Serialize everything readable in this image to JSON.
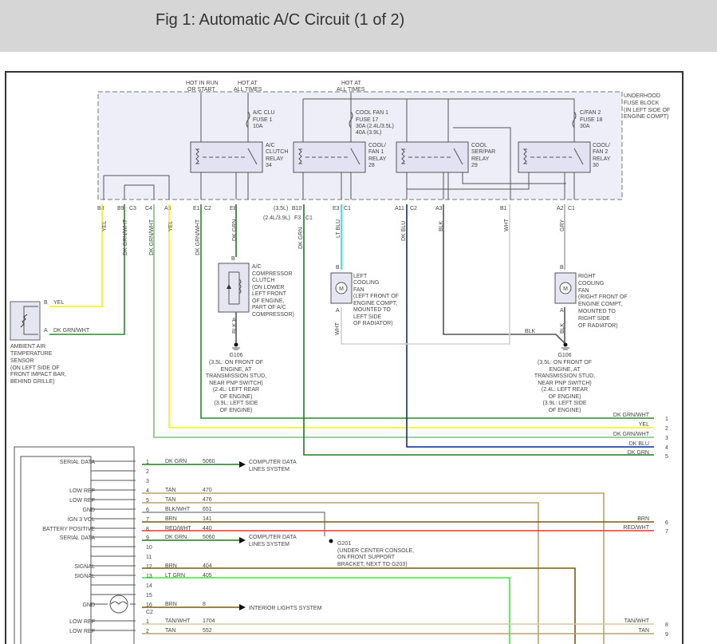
{
  "title": "Fig 1: Automatic A/C Circuit (1 of 2)",
  "colors": {
    "yel": "#f5f500",
    "dkgrnwht": "#2a8a2a",
    "dkgrnwht_lt": "#7fbf7f",
    "dkgrn": "#1f7a1f",
    "ltblu": "#00e5ff",
    "dkblu": "#0a2a9a",
    "blk": "#555555",
    "wht": "#cfcfcf",
    "gry": "#aaaaaa",
    "tan": "#b9a36a",
    "brn": "#7a5a10",
    "red": "#ff3030",
    "ltgrn": "#33ee33",
    "fuseblock": "#eeeef8"
  },
  "fuse_block": {
    "sources": [
      "HOT IN RUN",
      "OR START",
      "HOT AT",
      "ALL TIMES",
      "HOT AT",
      "ALL TIMES"
    ],
    "label": [
      "UNDERHOOD",
      "FUSE BLOCK",
      "(IN LEFT SIDE OF",
      "ENGINE COMPT)"
    ],
    "fuse1": [
      "A/C CLU",
      "FUSE 1",
      "10A"
    ],
    "fuse17": [
      "COOL FAN 1",
      "FUSE 17",
      "30A  (2.4L/3.5L)",
      "40A  (3.9L)"
    ],
    "fuse18": [
      "C/FAN 2",
      "FUSE 18",
      "30A"
    ],
    "relay34": [
      "A/C",
      "CLUTCH",
      "RELAY",
      "34"
    ],
    "relay28": [
      "COOL/",
      "FAN 1",
      "RELAY",
      "28"
    ],
    "relay29": [
      "COOL",
      "SER/PAR",
      "RELAY",
      "29"
    ],
    "relay30": [
      "COOL/",
      "FAN 2",
      "RELAY",
      "30"
    ]
  },
  "pins": [
    "B8",
    "B9",
    "C3",
    "C4",
    "A5",
    "E1",
    "C2",
    "E8",
    "(3.5L)",
    "B10",
    "(2.4L/3.9L)",
    "F3",
    "C1",
    "E3",
    "C1",
    "A11",
    "C2",
    "A3",
    "B1",
    "A2",
    "C1"
  ],
  "wire_labels": [
    "YEL",
    "DK GRN/WHT",
    "DK GRN/WHT",
    "YEL",
    "DK GRN/WHT",
    "DK GRN",
    "DK GRN",
    "LT BLU",
    "DK BLU",
    "BLK",
    "WHT",
    "GRY",
    "BLK",
    "WHT",
    "BLK",
    "BLK"
  ],
  "sensor": {
    "pin_b": "B",
    "pin_a": "A",
    "wire_b": "YEL",
    "wire_a": "DK GRN/WHT",
    "label": [
      "AMBIENT AIR",
      "TEMPERATURE",
      "SENSOR",
      "(ON LEFT SIDE OF",
      "FRONT IMPACT BAR,",
      "BEHIND GRILLE)"
    ]
  },
  "clutch": {
    "pin_b": "B",
    "pin_a": "A",
    "label": [
      "A/C",
      "COMPRESSOR",
      "CLUTCH",
      "(ON LOWER",
      "LEFT FRONT",
      "OF ENGINE,",
      "PART OF A/C",
      "COMPRESSOR)"
    ]
  },
  "left_fan": {
    "pin_b": "B",
    "pin_a": "A",
    "motor": "M",
    "label": [
      "LEFT",
      "COOLING",
      "FAN",
      "(LEFT FRONT OF",
      "ENGINE COMPT,",
      "MOUNTED TO",
      "LEFT SIDE",
      "OF RADIATOR)"
    ]
  },
  "right_fan": {
    "pin_b": "B",
    "pin_a": "A",
    "motor": "M",
    "label": [
      "RIGHT",
      "COOLING",
      "FAN",
      "(RIGHT FRONT OF",
      "ENGINE COMPT,",
      "MOUNTED TO",
      "RIGHT SIDE",
      "OF RADIATOR)"
    ]
  },
  "ground_g106": [
    "G106",
    "(3.5L: ON FRONT OF",
    "ENGINE, AT",
    "TRANSMISSION STUD,",
    "NEAR PNP SWITCH)",
    "(2.4L: LEFT REAR",
    "OF ENGINE)",
    "(3.9L: LEFT SIDE",
    "OF ENGINE)"
  ],
  "ground_g201": [
    "G201",
    "(UNDER CENTER CONSOLE,",
    "ON FRONT SUPPORT",
    "BRACKET, NEXT TO G203)"
  ],
  "offpage_top": [
    {
      "label": "DK GRN/WHT",
      "num": "1"
    },
    {
      "label": "YEL",
      "num": "2"
    },
    {
      "label": "DK GRN/WHT",
      "num": "3"
    },
    {
      "label": "DK BLU",
      "num": "4"
    },
    {
      "label": "DK GRN",
      "num": "5"
    }
  ],
  "offpage_bottom": [
    {
      "label": "BRN",
      "num": "6"
    },
    {
      "label": "RED/WHT",
      "num": "7"
    },
    {
      "label": "TAN/WHT",
      "num": "8"
    },
    {
      "label": "TAN",
      "num": "9"
    }
  ],
  "module_rows": [
    {
      "sig": "SERIAL DATA",
      "pin": "1",
      "color": "DK GRN",
      "circuit": "5060",
      "dest": [
        "COMPUTER DATA",
        "LINES SYSTEM"
      ]
    },
    {
      "sig": "",
      "pin": "2",
      "color": "",
      "circuit": ""
    },
    {
      "sig": "",
      "pin": "3",
      "color": "",
      "circuit": ""
    },
    {
      "sig": "LOW REF",
      "pin": "4",
      "color": "TAN",
      "circuit": "470"
    },
    {
      "sig": "LOW REF",
      "pin": "5",
      "color": "TAN",
      "circuit": "476"
    },
    {
      "sig": "GND",
      "pin": "6",
      "color": "BLK/WHT",
      "circuit": "651"
    },
    {
      "sig": "IGN 3 VOL",
      "pin": "7",
      "color": "BRN",
      "circuit": "141"
    },
    {
      "sig": "BATTERY POSITIVE",
      "pin": "8",
      "color": "RED/WHT",
      "circuit": "440"
    },
    {
      "sig": "SERIAL DATA",
      "pin": "9",
      "color": "DK GRN",
      "circuit": "5060",
      "dest": [
        "COMPUTER DATA",
        "LINES SYSTEM"
      ]
    },
    {
      "sig": "",
      "pin": "10",
      "color": "",
      "circuit": ""
    },
    {
      "sig": "",
      "pin": "11",
      "color": "",
      "circuit": ""
    },
    {
      "sig": "SIGNAL",
      "pin": "12",
      "color": "BRN",
      "circuit": "404"
    },
    {
      "sig": "SIGNAL",
      "pin": "13",
      "color": "LT GRN",
      "circuit": "405"
    },
    {
      "sig": "",
      "pin": "14",
      "color": "",
      "circuit": ""
    },
    {
      "sig": "",
      "pin": "15",
      "color": "",
      "circuit": ""
    },
    {
      "sig": "GND",
      "pin": "16",
      "color": "BRN",
      "circuit": "8",
      "dest": [
        "INTERIOR LIGHTS SYSTEM"
      ]
    },
    {
      "sig": "LOW REF",
      "pin": "1",
      "color": "TAN/WHT",
      "circuit": "1704"
    },
    {
      "sig": "LOW REF",
      "pin": "2",
      "color": "TAN",
      "circuit": "552"
    }
  ],
  "connector_c2": "C2"
}
